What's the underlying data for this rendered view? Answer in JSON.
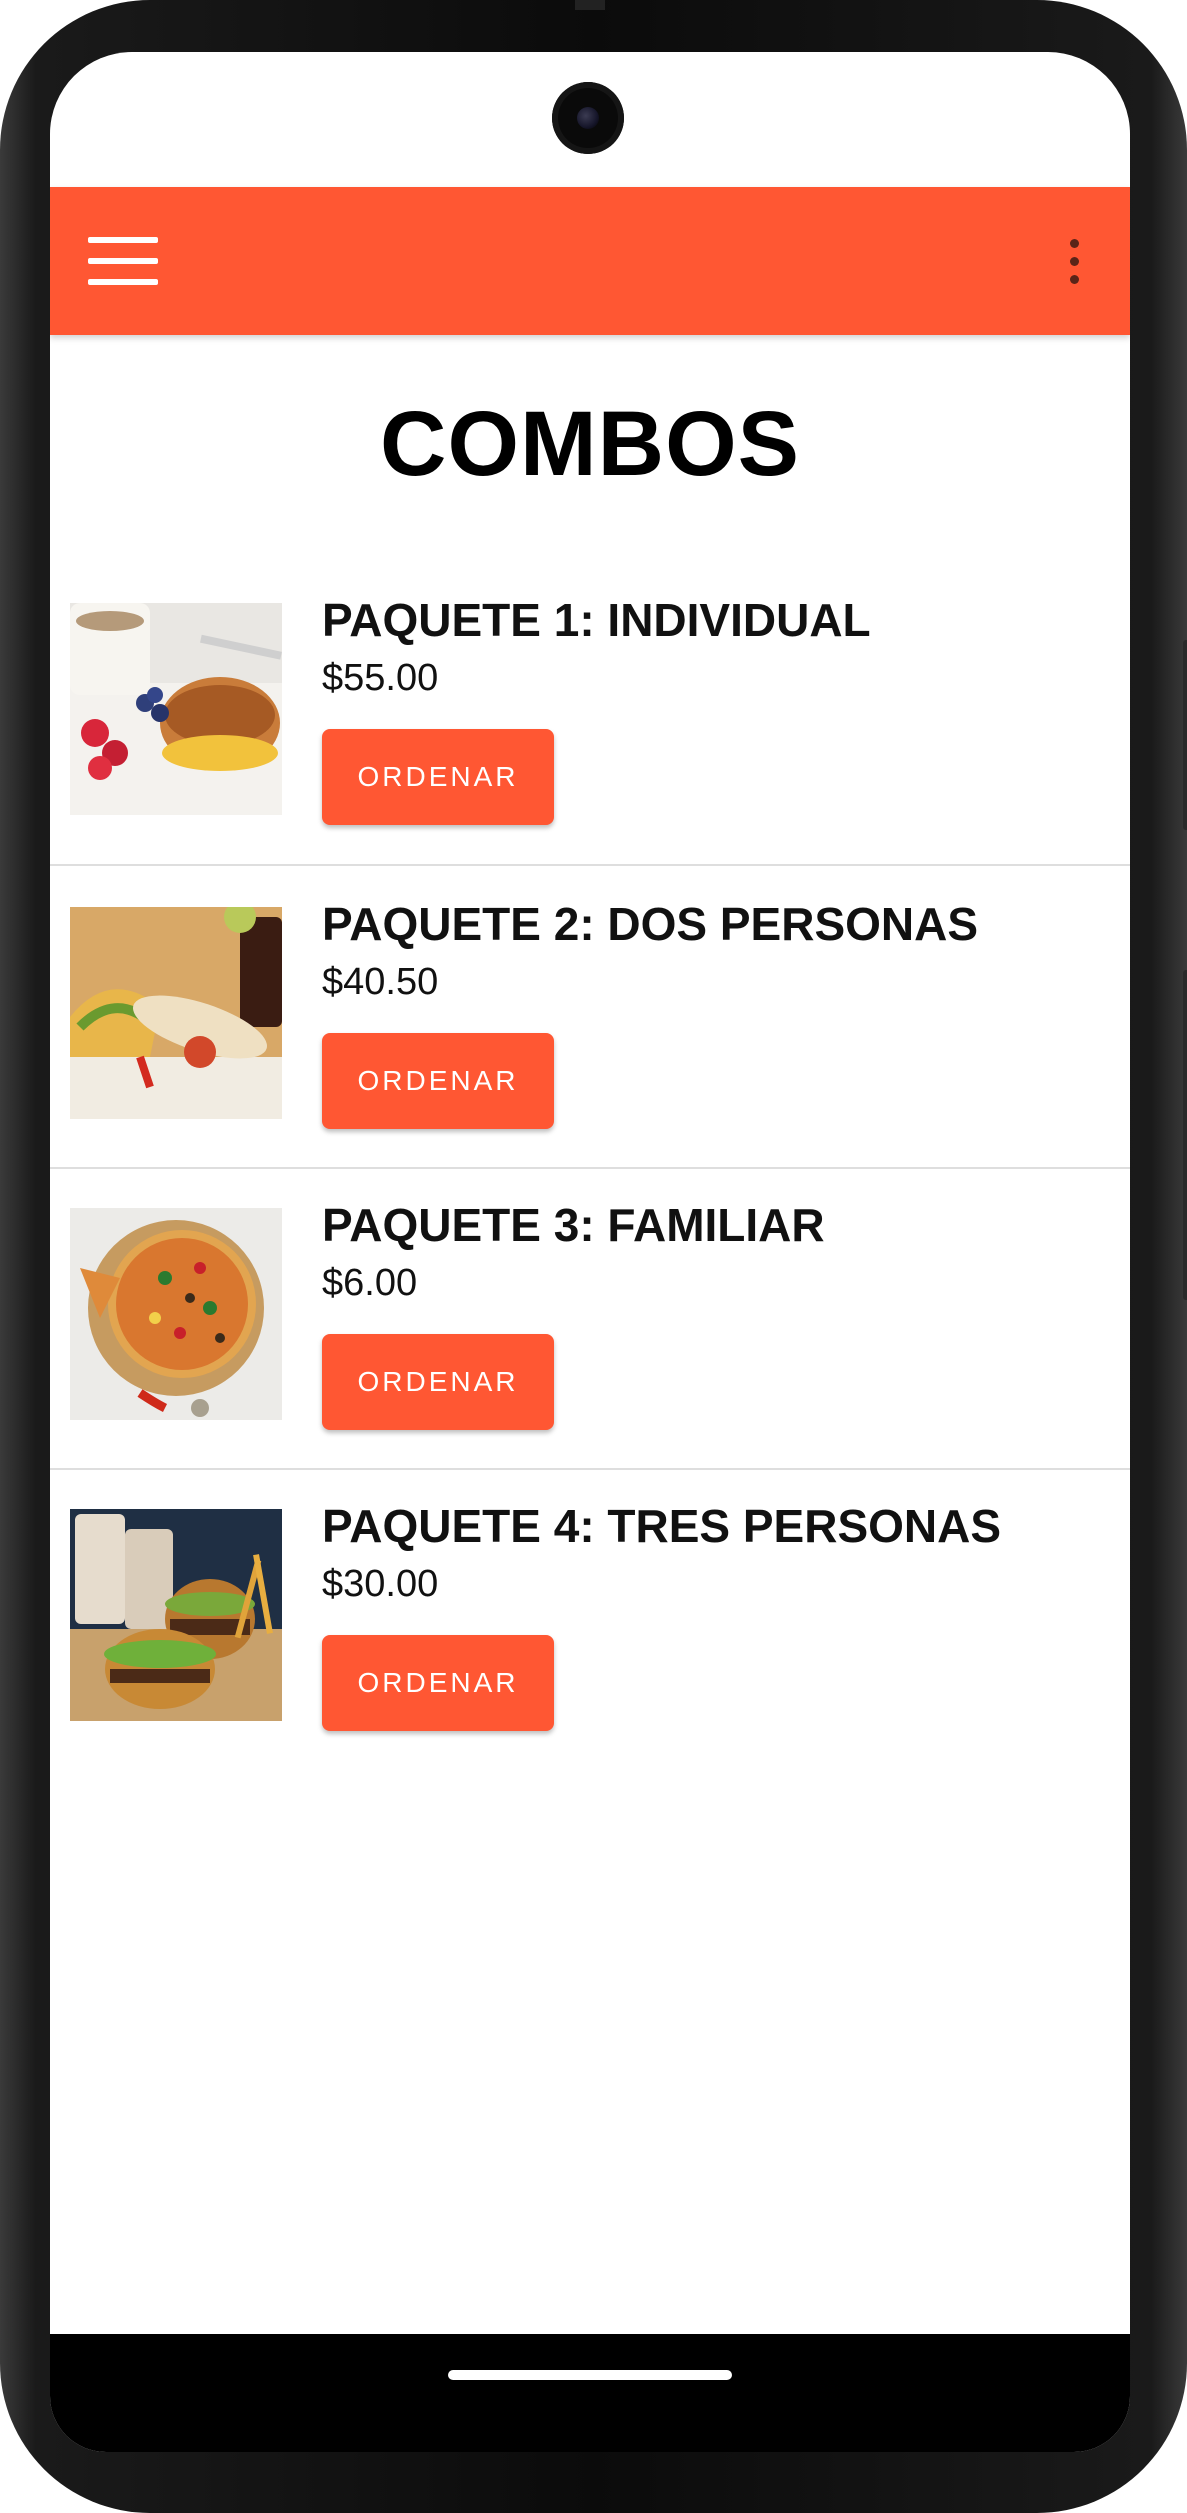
{
  "appbar": {
    "color": "#FF5733",
    "menu_icon": "hamburger-menu-icon",
    "overflow_icon": "more-vert-icon"
  },
  "page": {
    "title": "COMBOS"
  },
  "combos": [
    {
      "name": "PAQUETE 1: INDIVIDUAL",
      "price": "$55.00",
      "button_label": "ORDENAR",
      "image": "breakfast-platter"
    },
    {
      "name": "PAQUETE 2: DOS PERSONAS",
      "price": "$40.50",
      "button_label": "ORDENAR",
      "image": "tacos-burritos"
    },
    {
      "name": "PAQUETE 3: FAMILIAR",
      "price": "$6.00",
      "button_label": "ORDENAR",
      "image": "pizza"
    },
    {
      "name": "PAQUETE 4: TRES PERSONAS",
      "price": "$30.00",
      "button_label": "ORDENAR",
      "image": "burgers-fries-shakes"
    }
  ],
  "accent": "#FF5733"
}
